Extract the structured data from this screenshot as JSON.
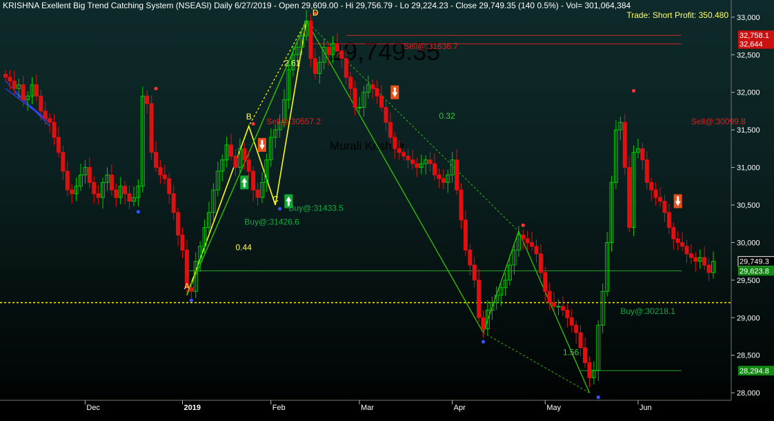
{
  "header": {
    "symbol_line": "KRISHNA Exellent Big Trend Catching System (NSEASI) Daily  6/27/2019  -  Open 29,609.00  -  Hi 29,756.79  -  Lo 29,224.23  -  Close 29,749.35 (140 0.5%)  -  Vol= 301,064,384",
    "trade_profit": "Trade: Short Profit:  350.480"
  },
  "watermark": "29,749.35",
  "author": "Murali Krishna",
  "colors": {
    "up": "#00cc00",
    "down": "#e01010",
    "buy": "#00aa44",
    "sell": "#e02020",
    "fib": "#ffff00",
    "zig": "#33bb00"
  },
  "chart_data": {
    "type": "candlestick",
    "ylim": [
      27900,
      33100
    ],
    "y_ticks": [
      {
        "v": 33000,
        "label": "33,000"
      },
      {
        "v": 32500,
        "label": "32,500"
      },
      {
        "v": 32000,
        "label": "32,000"
      },
      {
        "v": 31500,
        "label": "31,500"
      },
      {
        "v": 31000,
        "label": "31,000"
      },
      {
        "v": 30500,
        "label": "30,500"
      },
      {
        "v": 30000,
        "label": "30,000"
      },
      {
        "v": 29500,
        "label": "29,500"
      },
      {
        "v": 29000,
        "label": "29,000"
      },
      {
        "v": 28500,
        "label": "28,500"
      },
      {
        "v": 28000,
        "label": "28,000"
      }
    ],
    "x_ticks": [
      {
        "i": 18,
        "label": "Dec",
        "bold": false
      },
      {
        "i": 40,
        "label": "2019",
        "bold": true
      },
      {
        "i": 60,
        "label": "Feb",
        "bold": false
      },
      {
        "i": 80,
        "label": "Mar",
        "bold": false
      },
      {
        "i": 101,
        "label": "Apr",
        "bold": false
      },
      {
        "i": 122,
        "label": "May",
        "bold": false
      },
      {
        "i": 143,
        "label": "Jun",
        "bold": false
      }
    ],
    "price_tags": [
      {
        "v": 32758.1,
        "label": "32,758.1",
        "bg": "#cc1111",
        "fg": "#fff"
      },
      {
        "v": 32644,
        "label": "32,644",
        "bg": "#cc1111",
        "fg": "#fff"
      },
      {
        "v": 29749.3,
        "label": "29,749.3",
        "bg": "#000",
        "fg": "#fff"
      },
      {
        "v": 29623.8,
        "label": "29,623.8",
        "bg": "#118811",
        "fg": "#fff"
      },
      {
        "v": 28294.8,
        "label": "28,294.8",
        "bg": "#118811",
        "fg": "#fff"
      }
    ],
    "hlines": [
      {
        "v": 32758.1,
        "from": 77,
        "color": "#cc2222"
      },
      {
        "v": 32644,
        "from": 69,
        "color": "#cc2222"
      },
      {
        "v": 29623.8,
        "from": 41,
        "color": "#22aa22"
      },
      {
        "v": 28294.8,
        "from": 130,
        "color": "#22aa22"
      }
    ],
    "support_line": 29200,
    "closes": [
      32200,
      32150,
      32050,
      32100,
      31900,
      31950,
      32100,
      31950,
      31750,
      31650,
      31600,
      31400,
      31200,
      30950,
      30700,
      30650,
      30750,
      30900,
      31000,
      30800,
      30650,
      30600,
      30800,
      30900,
      30700,
      30600,
      30750,
      30650,
      30550,
      30600,
      30750,
      31950,
      31850,
      31200,
      31000,
      30900,
      30850,
      30650,
      30400,
      30100,
      29900,
      29400,
      29350,
      29750,
      29950,
      30200,
      30400,
      30700,
      30950,
      31100,
      31300,
      31150,
      31000,
      31250,
      31100,
      30950,
      30700,
      30600,
      30800,
      31100,
      31400,
      31500,
      31600,
      31900,
      32300,
      32500,
      32600,
      32750,
      32950,
      32450,
      32250,
      32400,
      32600,
      32500,
      32650,
      32550,
      32450,
      32200,
      32050,
      31800,
      31800,
      32000,
      32100,
      32050,
      31950,
      31800,
      31600,
      31400,
      31250,
      31200,
      31150,
      31100,
      31050,
      31000,
      31050,
      31100,
      31050,
      30900,
      30850,
      30800,
      30900,
      31100,
      30700,
      30300,
      29900,
      29700,
      29500,
      29000,
      28850,
      29100,
      29200,
      29300,
      29400,
      29500,
      29700,
      29900,
      30100,
      30050,
      30000,
      29950,
      29850,
      29600,
      29350,
      29200,
      29150,
      29150,
      29100,
      29000,
      28900,
      28800,
      28600,
      28400,
      28200,
      28300,
      28900,
      29350,
      30000,
      30800,
      31500,
      31600,
      31000,
      30200,
      31200,
      31250,
      31100,
      30800,
      30700,
      30600,
      30550,
      30400,
      30200,
      30050,
      30000,
      29950,
      29850,
      29800,
      29750,
      29800,
      29700,
      29600,
      29750
    ],
    "zig_points": [
      [
        41,
        29300
      ],
      [
        68,
        32950
      ],
      [
        108,
        28800
      ],
      [
        116,
        30150
      ],
      [
        132,
        28000
      ]
    ],
    "fib_lines": [
      [
        41,
        29300,
        55,
        31550,
        68,
        32950
      ],
      [
        41,
        29300,
        68,
        32950
      ]
    ],
    "ratio_labels": [
      {
        "i": 63,
        "v": 32350,
        "text": "2.61",
        "color": "#ffff66"
      },
      {
        "i": 52,
        "v": 29900,
        "text": "0.44",
        "color": "#ffff66"
      },
      {
        "i": 98,
        "v": 31650,
        "text": "0.32",
        "color": "#33cc33"
      },
      {
        "i": 126,
        "v": 28500,
        "text": "1.56",
        "color": "#33cc33"
      }
    ],
    "point_labels": [
      {
        "i": 41,
        "v": 29380,
        "text": "A",
        "color": "#ffff66"
      },
      {
        "i": 55,
        "v": 31640,
        "text": "B",
        "color": "#ffff66"
      },
      {
        "i": 61,
        "v": 30540,
        "text": "C",
        "color": "#ffff66"
      },
      {
        "i": 70,
        "v": 33020,
        "text": "D",
        "color": "#ffff66"
      }
    ],
    "signals": [
      {
        "i": 59,
        "v": 31575,
        "text": "Sell@:30557.2",
        "color": "#e02020"
      },
      {
        "i": 90,
        "v": 32575,
        "text": "Sell@:31636.7",
        "color": "#e02020"
      },
      {
        "i": 155,
        "v": 31575,
        "text": "Sell@:30099.8",
        "color": "#e02020"
      },
      {
        "i": 54,
        "v": 30240,
        "text": "Buy@:31426.6",
        "color": "#11aa44"
      },
      {
        "i": 64,
        "v": 30420,
        "text": "Buy@:31433.5",
        "color": "#11aa44"
      },
      {
        "i": 139,
        "v": 29050,
        "text": "Buy@:30218.1",
        "color": "#11aa44"
      }
    ],
    "arrows": [
      {
        "i": 58,
        "v": 31300,
        "dir": "down"
      },
      {
        "i": 88,
        "v": 32000,
        "dir": "down"
      },
      {
        "i": 152,
        "v": 30550,
        "dir": "down"
      },
      {
        "i": 54,
        "v": 30800,
        "dir": "up"
      },
      {
        "i": 64,
        "v": 30550,
        "dir": "up"
      }
    ],
    "dots": [
      {
        "i": 30,
        "v": 30410,
        "color": "#3355ff"
      },
      {
        "i": 42,
        "v": 29230,
        "color": "#3355ff"
      },
      {
        "i": 62,
        "v": 30450,
        "color": "#3355ff"
      },
      {
        "i": 108,
        "v": 28680,
        "color": "#3355ff"
      },
      {
        "i": 134,
        "v": 27940,
        "color": "#3355ff"
      },
      {
        "i": 34,
        "v": 32050,
        "color": "#ff3333"
      },
      {
        "i": 56,
        "v": 31580,
        "color": "#ff3333"
      },
      {
        "i": 70,
        "v": 33050,
        "color": "#ff3333"
      },
      {
        "i": 117,
        "v": 30230,
        "color": "#ff3333"
      },
      {
        "i": 142,
        "v": 32020,
        "color": "#ff3333"
      }
    ]
  }
}
